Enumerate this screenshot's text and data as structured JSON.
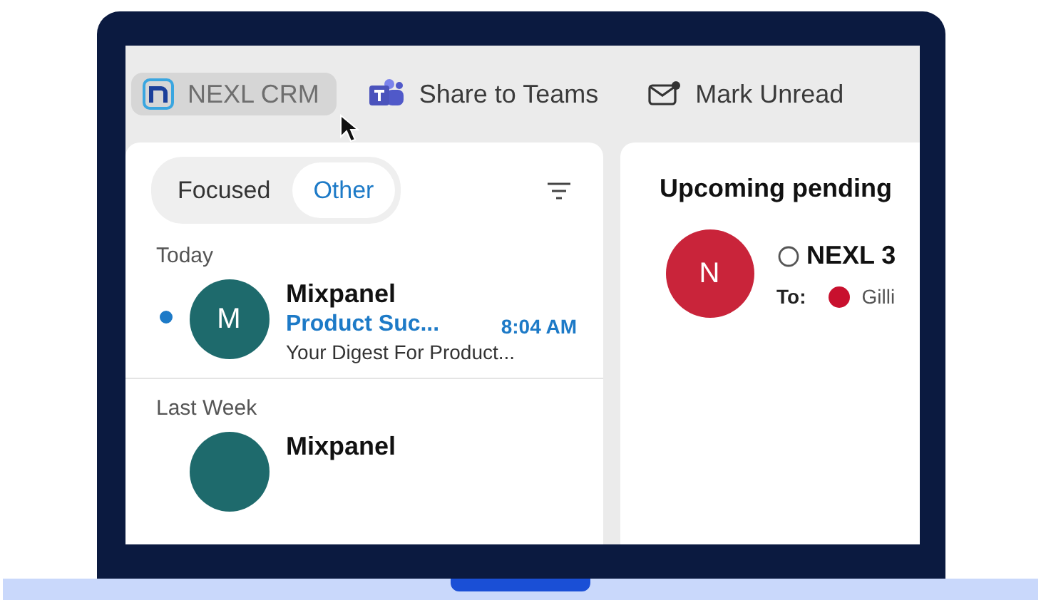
{
  "toolbar": [
    {
      "label": "NEXL CRM",
      "kind": "nexl",
      "selected": true
    },
    {
      "label": "Share to Teams",
      "kind": "teams",
      "selected": false
    },
    {
      "label": "Mark Unread",
      "kind": "mail",
      "selected": false
    }
  ],
  "mail_list": {
    "tabs": [
      {
        "label": "Focused",
        "selected": false
      },
      {
        "label": "Other",
        "selected": true
      }
    ],
    "groups": [
      {
        "heading": "Today",
        "messages": [
          {
            "avatar": "M",
            "sender": "Mixpanel",
            "subject": "Product Suc...",
            "time": "8:04 AM",
            "preview": "Your Digest For Product...",
            "unread": true
          }
        ]
      },
      {
        "heading": "Last Week",
        "messages": [
          {
            "sender": "Mixpanel",
            "unread": false
          }
        ]
      }
    ]
  },
  "reading_pane": {
    "title": "Upcoming pending",
    "avatar": "N",
    "subject": "NEXL 3",
    "to_label": "To:",
    "recipients": [
      {
        "name": "Gilli",
        "color": "#c8102e"
      }
    ]
  }
}
